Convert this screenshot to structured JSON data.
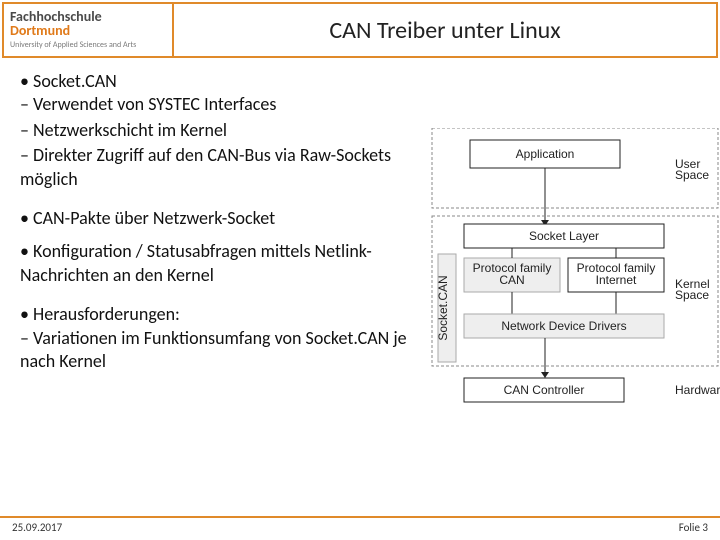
{
  "logo": {
    "line1a": "Fachhochschule",
    "line1b": "Dortmund",
    "line2": "University of Applied Sciences and Arts"
  },
  "title": "CAN Treiber unter Linux",
  "bullets": {
    "b0": "Socket.CAN",
    "b0s0": "Verwendet von SYSTEC Interfaces",
    "b0s1": "Netzwerkschicht im Kernel",
    "b0s2": "Direkter Zugriff auf den CAN-Bus via Raw-Sockets möglich",
    "b1": "CAN-Pakte über Netzwerk-Socket",
    "b2": "Konfiguration / Statusabfragen mittels Netlink-Nachrichten an den Kernel",
    "b3": "Herausforderungen:",
    "b3s0": "Variationen im Funktionsumfang von Socket.CAN je nach Kernel"
  },
  "diagram": {
    "application": "Application",
    "user_space": "User Space",
    "socket_layer": "Socket Layer",
    "pf_can": "Protocol family CAN",
    "pf_inet": "Protocol family Internet",
    "kernel_space": "Kernel Space",
    "netdev": "Network Device Drivers",
    "socketcan_label": "Socket.CAN",
    "can_controller": "CAN Controller",
    "hardware": "Hardware"
  },
  "footer": {
    "date": "25.09.2017",
    "page": "Folie 3"
  }
}
